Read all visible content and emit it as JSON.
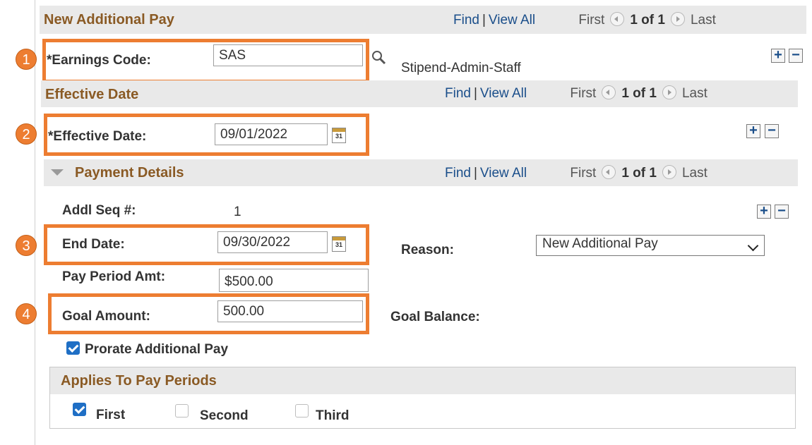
{
  "section1": {
    "title": "New Additional Pay",
    "nav": {
      "find": "Find",
      "sep": "|",
      "view_all": "View All",
      "first": "First",
      "count": "1 of 1",
      "last": "Last"
    },
    "earnings_label": "*Earnings Code:",
    "earnings_value": "SAS",
    "earnings_desc": "Stipend-Admin-Staff",
    "badge": "1"
  },
  "section2": {
    "title": "Effective Date",
    "nav": {
      "find": "Find",
      "sep": "|",
      "view_all": "View All",
      "first": "First",
      "count": "1 of 1",
      "last": "Last"
    },
    "date_label": "*Effective Date:",
    "date_value": "09/01/2022",
    "badge": "2"
  },
  "section3": {
    "title": "Payment Details",
    "nav": {
      "find": "Find",
      "sep": "|",
      "view_all": "View All",
      "first": "First",
      "count": "1 of 1",
      "last": "Last"
    },
    "seq_label": "Addl Seq #:",
    "seq_value": "1",
    "end_label": "End Date:",
    "end_value": "09/30/2022",
    "reason_label": "Reason:",
    "reason_value": "New Additional Pay",
    "pay_label": "Pay Period Amt:",
    "pay_value": "$500.00",
    "goal_label": "Goal Amount:",
    "goal_value": "500.00",
    "goal_balance_label": "Goal Balance:",
    "prorate_label": "Prorate Additional Pay",
    "prorate_checked": true,
    "badge3": "3",
    "badge4": "4"
  },
  "applies": {
    "title": "Applies To Pay Periods",
    "first": "First",
    "second": "Second",
    "third": "Third",
    "first_checked": true,
    "second_checked": false,
    "third_checked": false
  },
  "icons": {
    "calendar": "31",
    "add": "+",
    "remove": "−"
  },
  "colors": {
    "highlight": "#ed7d31",
    "section_title": "#8a5a24",
    "link": "#1a4e8a",
    "checkbox": "#1f6fc5"
  }
}
